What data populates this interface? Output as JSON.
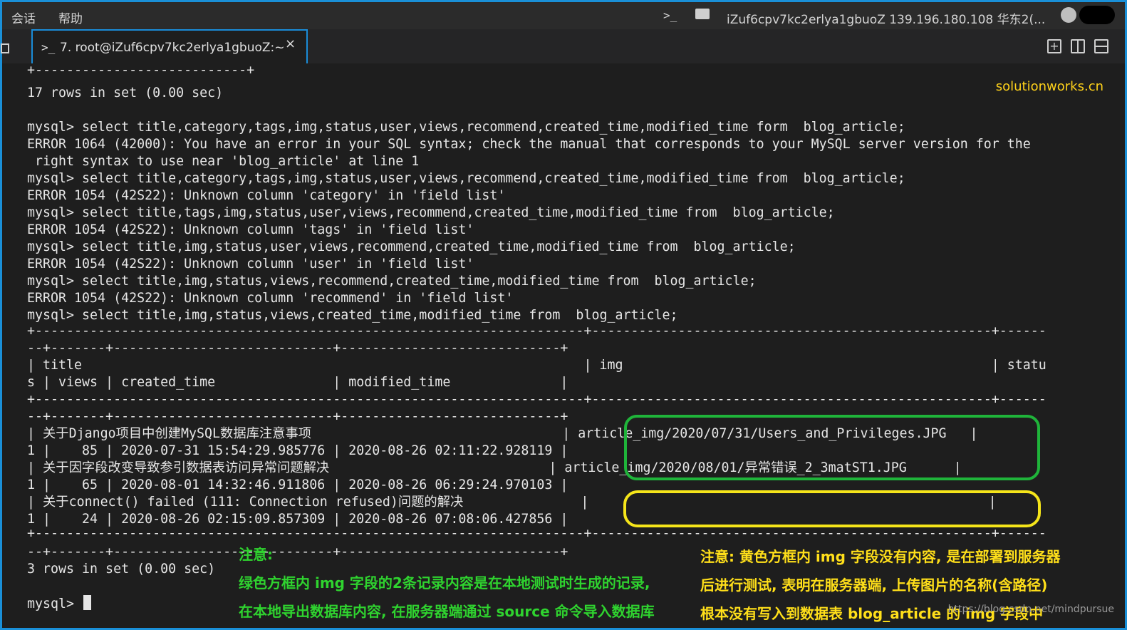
{
  "menubar": {
    "items": [
      "会话",
      "帮助"
    ],
    "session_info": "iZuf6cpv7kc2erlya1gbuoZ 139.196.180.108 华东2(..."
  },
  "tab": {
    "label": "7. root@iZuf6cpv7kc2erlya1gbuoZ:~",
    "close": "×"
  },
  "icons": {
    "terminal": "terminal-icon",
    "folder": "folder-icon",
    "avatar": "avatar-icon",
    "new_tab": "plus-square-icon",
    "split_v": "split-vertical-icon",
    "split_h": "split-horizontal-icon"
  },
  "watermark": "solutionworks.cn",
  "terminal": {
    "lines": [
      "+---------------------------+",
      "17 rows in set (0.00 sec)",
      "",
      "mysql> select title,category,tags,img,status,user,views,recommend,created_time,modified_time form  blog_article;",
      "ERROR 1064 (42000): You have an error in your SQL syntax; check the manual that corresponds to your MySQL server version for the",
      " right syntax to use near 'blog_article' at line 1",
      "mysql> select title,category,tags,img,status,user,views,recommend,created_time,modified_time from  blog_article;",
      "ERROR 1054 (42S22): Unknown column 'category' in 'field list'",
      "mysql> select title,tags,img,status,user,views,recommend,created_time,modified_time from  blog_article;",
      "ERROR 1054 (42S22): Unknown column 'tags' in 'field list'",
      "mysql> select title,img,status,user,views,recommend,created_time,modified_time from  blog_article;",
      "ERROR 1054 (42S22): Unknown column 'user' in 'field list'",
      "mysql> select title,img,status,views,recommend,created_time,modified_time from  blog_article;",
      "ERROR 1054 (42S22): Unknown column 'recommend' in 'field list'",
      "mysql> select title,img,status,views,created_time,modified_time from  blog_article;",
      "+----------------------------------------------------------------------+---------------------------------------------------+------",
      "--+-------+----------------------------+----------------------------+",
      "| title                                                                | img                                               | statu",
      "s | views | created_time               | modified_time              |",
      "+----------------------------------------------------------------------+---------------------------------------------------+------",
      "--+-------+----------------------------+----------------------------+",
      "| 关于Django项目中创建MySQL数据库注意事项                                | article_img/2020/07/31/Users_and_Privileges.JPG   |",
      "1 |    85 | 2020-07-31 15:54:29.985776 | 2020-08-26 02:11:22.928119 |",
      "| 关于因字段改变导致参引数据表访问异常问题解决                            | article_img/2020/08/01/异常错误_2_3matST1.JPG      |",
      "1 |    65 | 2020-08-01 14:32:46.911806 | 2020-08-26 06:29:24.970103 |",
      "| 关于connect() failed (111: Connection refused)问题的解决               |                                                   |",
      "1 |    24 | 2020-08-26 02:15:09.857309 | 2020-08-26 07:08:06.427856 |",
      "+----------------------------------------------------------------------+---------------------------------------------------+------",
      "--+-------+----------------------------+----------------------------+",
      "",
      "3 rows in set (0.00 sec)",
      "",
      "mysql> "
    ]
  },
  "notes": {
    "green_title": "注意:",
    "green_line1": "绿色方框内 img 字段的2条记录内容是在本地测试时生成的记录,",
    "green_line2": "在本地导出数据库内容, 在服务器端通过 source 命令导入数据库",
    "yellow_line1": "注意: 黄色方框内 img 字段没有内容, 是在部署到服务器",
    "yellow_line2": "后进行测试, 表明在服务器端, 上传图片的名称(含路径)",
    "yellow_line3": "根本没有写入到数据表 blog_article 的 img 字段中"
  },
  "csdn_mark": "https://blog.csdn.net/mindpursue"
}
